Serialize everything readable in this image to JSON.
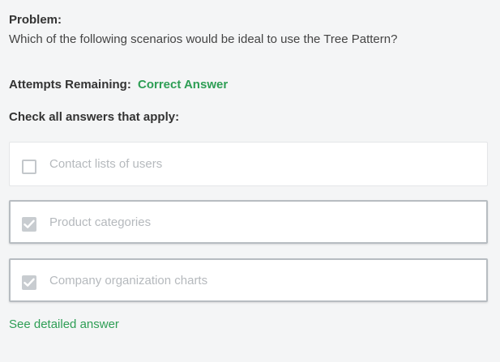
{
  "problem": {
    "title": "Problem:",
    "question": "Which of the following scenarios would be ideal to use the Tree Pattern?"
  },
  "attempts": {
    "label": "Attempts Remaining:",
    "status": "Correct Answer",
    "status_color": "#2e9e55"
  },
  "instructions": "Check all answers that apply:",
  "options": [
    {
      "label": "Contact lists of users",
      "checked": false,
      "icon": "checkbox-unchecked-icon"
    },
    {
      "label": "Product categories",
      "checked": true,
      "icon": "checkbox-checked-icon"
    },
    {
      "label": "Company organization charts",
      "checked": true,
      "icon": "checkbox-checked-icon"
    }
  ],
  "detail_link": "See detailed answer",
  "colors": {
    "accent_green": "#2e9e55",
    "background": "#f4f5f6",
    "option_text": "#b5b9bd"
  }
}
